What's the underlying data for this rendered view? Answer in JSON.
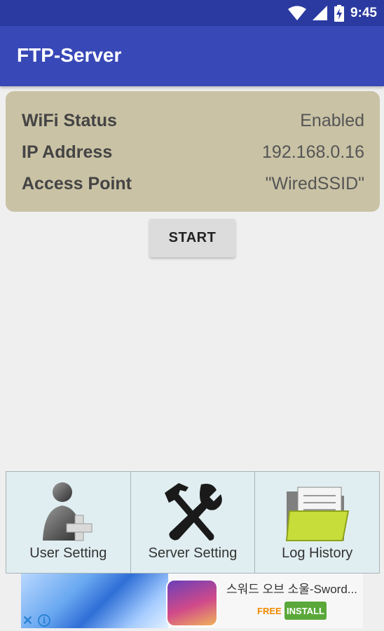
{
  "status_bar": {
    "time": "9:45",
    "icons": [
      "wifi-icon",
      "signal-icon",
      "battery-charging-icon"
    ]
  },
  "app_bar": {
    "title": "FTP-Server"
  },
  "info": {
    "rows": [
      {
        "label": "WiFi Status",
        "value": "Enabled"
      },
      {
        "label": "IP Address",
        "value": "192.168.0.16"
      },
      {
        "label": "Access Point",
        "value": "\"WiredSSID\""
      }
    ]
  },
  "start_label": "START",
  "tiles": [
    {
      "label": "User Setting",
      "icon": "user-add-icon"
    },
    {
      "label": "Server Setting",
      "icon": "tools-icon"
    },
    {
      "label": "Log History",
      "icon": "folder-icon"
    }
  ],
  "ad": {
    "app_name": "스워드 오브 소울-Sword...",
    "free": "FREE",
    "install": "INSTALL",
    "close_glyph": "✕",
    "info_glyph": "i"
  },
  "colors": {
    "status_bar": "#2b3aa0",
    "app_bar": "#3848b7",
    "info_card": "#c9c2a5",
    "tile_bg": "#e0eef1",
    "install_green": "#5aa83a"
  }
}
